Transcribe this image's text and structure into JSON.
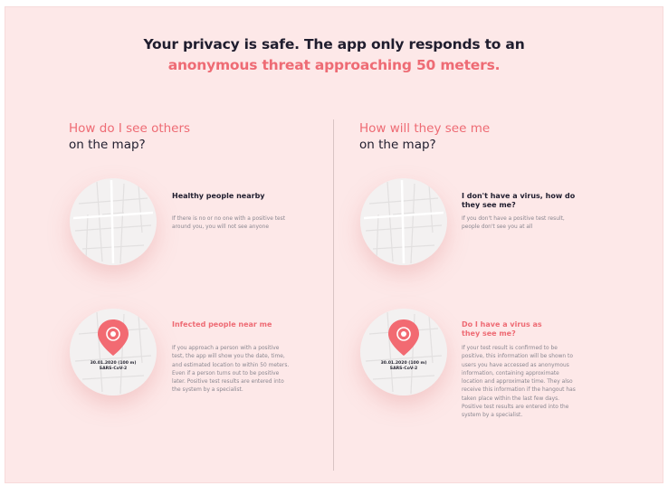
{
  "headline": {
    "line1": "Your privacy is safe. The app only responds to an",
    "line2": "anonymous threat approaching 50 meters."
  },
  "left_column": {
    "heading_accent": "How do I see others",
    "heading_rest": "on the map?",
    "cards": [
      {
        "title": "Healthy people nearby",
        "text": "If there is no or no one with a positive test around you, you will not see anyone"
      },
      {
        "title": "Infected people near me",
        "text": "If you approach a person with a positive test, the app will show you the date, time, and estimated location to within 50 meters. Even if a person turns out to be positive later. Positive test results are entered into the system by a specialist.",
        "pin_date": "30.01.2020 (100 m)",
        "pin_virus": "SARS-CoV-2"
      }
    ]
  },
  "right_column": {
    "heading_accent": "How will they see me",
    "heading_rest": "on the map?",
    "cards": [
      {
        "title": "I don't have a virus, how do they see me?",
        "text": "If you don't have a positive test result, people don't see you at all"
      },
      {
        "title": "Do I have a virus as they see me?",
        "text": "If your test result is confirmed to be positive, this information will be shown to users you have accessed as anonymous information, containing approximate location and approximate time. They also receive this information if the hangout has taken place within the last few days. Positive test results are entered into the system by a specialist.",
        "pin_date": "30.01.2020 (100 m)",
        "pin_virus": "SARS-CoV-2"
      }
    ]
  },
  "colors": {
    "background": "#fde8e8",
    "accent": "#ee6b74",
    "dark": "#1f1d2e",
    "muted": "#8a8790"
  },
  "icons": [
    "map-icon",
    "location-pin-icon"
  ]
}
